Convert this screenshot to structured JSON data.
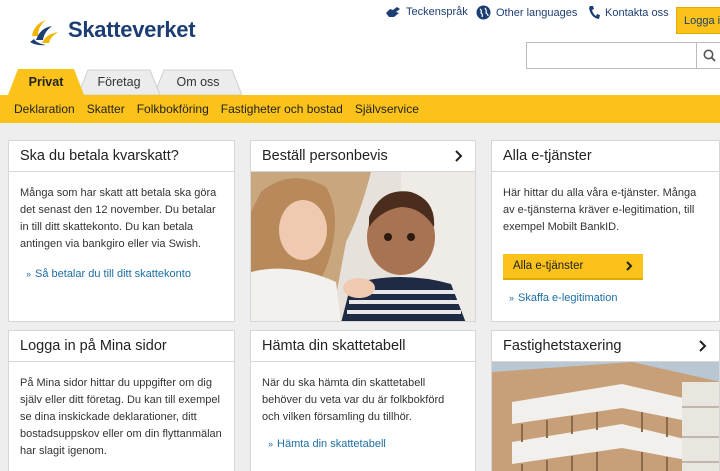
{
  "header": {
    "logo_text": "Skatteverket",
    "links": {
      "sign_language": "Teckenspråk",
      "other_languages": "Other languages",
      "contact": "Kontakta oss",
      "login": "Logga in"
    },
    "search": {
      "placeholder": ""
    }
  },
  "tabs": {
    "privat": "Privat",
    "foretag": "Företag",
    "omoss": "Om oss"
  },
  "subnav": {
    "deklaration": "Deklaration",
    "skatter": "Skatter",
    "folkbokforing": "Folkbokföring",
    "fastigheter": "Fastigheter och bostad",
    "sjalvservice": "Självservice"
  },
  "cards": {
    "kvarskatt": {
      "title": "Ska du betala kvarskatt?",
      "text": "Många som har skatt att betala ska göra det senast den 12 november. Du betalar in till ditt skattekonto. Du kan betala antingen via bankgiro eller via Swish.",
      "link": "Så betalar du till ditt skattekonto"
    },
    "personbevis": {
      "title": "Beställ personbevis"
    },
    "etjanster": {
      "title": "Alla e-tjänster",
      "text": "Här hittar du alla våra e-tjänster. Många av e-tjänsterna kräver e-legitimation, till exempel Mobilt BankID.",
      "button": "Alla e-tjänster",
      "link": "Skaffa e-legitimation"
    },
    "minasidor": {
      "title": "Logga in på Mina sidor",
      "text": "På Mina sidor hittar du uppgifter om dig själv eller ditt företag. Du kan till exempel se dina inskickade deklarationer, ditt bostadsuppskov eller om din flyttanmälan har slagit igenom."
    },
    "skattetabell": {
      "title": "Hämta din skattetabell",
      "text": "När du ska hämta din skattetabell behöver du veta var du är folkbokförd och vilken församling du tillhör.",
      "link": "Hämta din skattetabell"
    },
    "fastighetstaxering": {
      "title": "Fastighetstaxering"
    }
  },
  "colors": {
    "brand_yellow": "#fbc31a",
    "brand_blue": "#1d3e73",
    "link_blue": "#1c6ea4"
  }
}
